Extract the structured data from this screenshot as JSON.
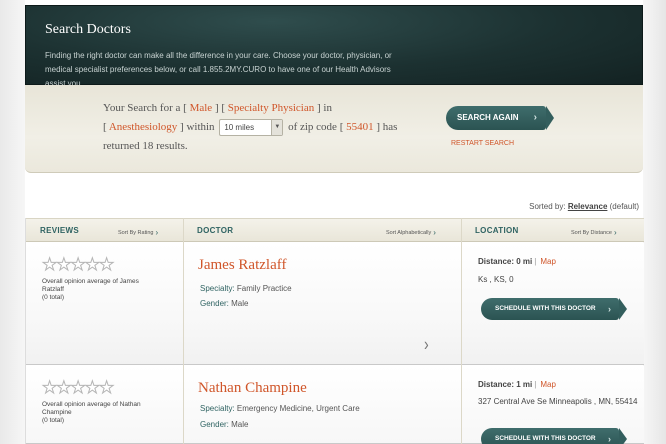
{
  "header": {
    "title": "Search Doctors",
    "intro": "Finding the right doctor can make all the difference in your care. Choose your doctor, physician, or medical specialist preferences below, or call 1.855.2MY.CURO to have one of our Health Advisors assist you."
  },
  "summary": {
    "p1": "Your Search for a",
    "gender": "Male",
    "type": "Specialty Physician",
    "p2": "in",
    "specialty": "Anesthesiology",
    "p3": "within",
    "distance_selected": "10 miles",
    "p4": "of zip code",
    "zip": "55401",
    "p5": "has returned 18 results.",
    "search_again": "SEARCH AGAIN",
    "restart": "RESTART SEARCH"
  },
  "sort": {
    "label": "Sorted by:",
    "value": "Relevance",
    "suffix": "(default)"
  },
  "columns": {
    "reviews": {
      "header": "REVIEWS",
      "sort": "Sort By Rating"
    },
    "doctor": {
      "header": "DOCTOR",
      "sort": "Sort Alphabetically"
    },
    "location": {
      "header": "LOCATION",
      "sort": "Sort By Distance"
    }
  },
  "results": [
    {
      "rating_text": "Overall opinion average of James Ratzlaff",
      "total": "(0 total)",
      "name": "James Ratzlaff",
      "specialty_label": "Specialty:",
      "specialty": "Family Practice",
      "gender_label": "Gender:",
      "gender": "Male",
      "distance_label": "Distance:",
      "distance": "0 mi",
      "map": "Map",
      "address": "Ks , KS, 0",
      "schedule": "SCHEDULE WITH THIS DOCTOR"
    },
    {
      "rating_text": "Overall opinion average of Nathan Champine",
      "total": "(0 total)",
      "name": "Nathan Champine",
      "specialty_label": "Specialty:",
      "specialty": "Emergency Medicine, Urgent Care",
      "gender_label": "Gender:",
      "gender": "Male",
      "distance_label": "Distance:",
      "distance": "1 mi",
      "map": "Map",
      "address": "327 Central Ave Se Minneapolis , MN, 55414",
      "schedule": "SCHEDULE WITH THIS DOCTOR"
    }
  ],
  "icons": {
    "star": "star-outline-icon",
    "chevron": "chevron-right-icon"
  },
  "colors": {
    "accent": "#d0562a",
    "teal": "#2f6362",
    "header_bg": "#1c3131"
  }
}
